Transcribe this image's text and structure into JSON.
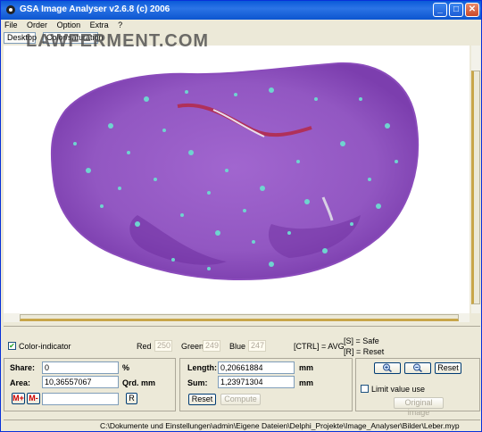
{
  "window": {
    "title": "GSA Image Analyser v2.6.8 (c) 2006",
    "minimize_glyph": "_",
    "maximize_glyph": "□",
    "close_glyph": "✕"
  },
  "menu": [
    "File",
    "Order",
    "Option",
    "Extra",
    "?"
  ],
  "tabs": [
    "Desktop",
    "Color/saturation"
  ],
  "watermark": "LAWFERMENT.COM",
  "color_indicator": {
    "label": "Color-indicator",
    "checked": true
  },
  "rgb": {
    "red_label": "Red",
    "red": "250",
    "green_label": "Green",
    "green": "249",
    "blue_label": "Blue",
    "blue": "247"
  },
  "hints": {
    "ctrl": "[CTRL] = AVG",
    "safe": "[S] = Safe",
    "reset": "[R] = Reset"
  },
  "share": {
    "label": "Share:",
    "value": "0",
    "unit": "%"
  },
  "area": {
    "label": "Area:",
    "value": "10,36557067",
    "unit": "Qrd. mm"
  },
  "markers": {
    "plus": "M+",
    "minus": "M-",
    "r_button": "R",
    "value": ""
  },
  "length": {
    "label": "Length:",
    "value": "0,20661884",
    "unit": "mm"
  },
  "sum": {
    "label": "Sum:",
    "value": "1,23971304",
    "unit": "mm"
  },
  "buttons": {
    "reset": "Reset",
    "compute": "Compute",
    "zoom_reset": "Reset",
    "original": "Original image"
  },
  "limit": {
    "label": "Limit value use",
    "checked": false
  },
  "status_path": "C:\\Dokumente und Einstellungen\\admin\\Eigene Dateien\\Delphi_Projekte\\Image_Analyser\\Bilder\\Leber.myp",
  "colors": {
    "tissue": "#9c5ec8",
    "tissue_dark": "#7a3aa8",
    "stain": "#6fd4d0",
    "vessel": "#b0305a",
    "titlebar": "#0a5bd8"
  }
}
